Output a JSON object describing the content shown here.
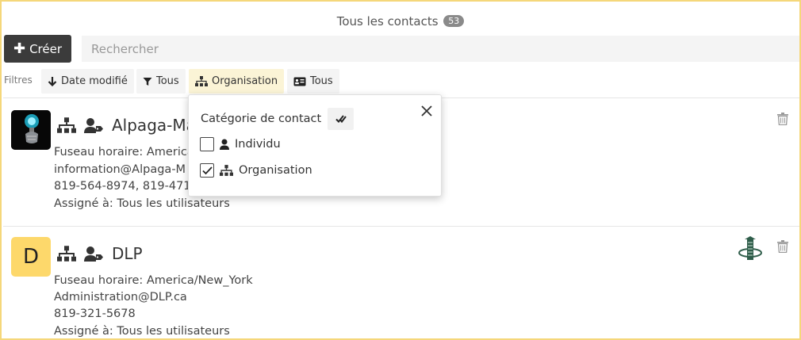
{
  "header": {
    "title": "Tous les contacts",
    "count": "53"
  },
  "toolbar": {
    "create_label": "Créer",
    "search_placeholder": "Rechercher"
  },
  "filters": {
    "label": "Filtres",
    "chips": [
      {
        "label": "Date modifié",
        "icon": "arrow-down-icon"
      },
      {
        "label": "Tous",
        "icon": "filter-icon"
      },
      {
        "label": "Organisation",
        "icon": "org-chart-icon",
        "active": true
      },
      {
        "label": "Tous",
        "icon": "id-card-icon"
      }
    ]
  },
  "popover": {
    "title": "Catégorie de contact",
    "options": [
      {
        "label": "Individu",
        "checked": false,
        "icon": "person-icon"
      },
      {
        "label": "Organisation",
        "checked": true,
        "icon": "org-chart-icon"
      }
    ]
  },
  "contacts": [
    {
      "name": "Alpaga-Ma",
      "avatar": "image",
      "timezone": "Fuseau horaire: America",
      "email": "information@Alpaga-M",
      "phone": "819-564-8974, 819-471-8",
      "assigned": "Assigné à: Tous les utilisateurs"
    },
    {
      "name": "DLP",
      "avatar_letter": "D",
      "timezone": "Fuseau horaire: America/New_York",
      "email": "Administration@DLP.ca",
      "phone": "819-321-5678",
      "assigned": "Assigné à: Tous les utilisateurs"
    }
  ],
  "colors": {
    "accent_border": "#f5d77a",
    "active_chip": "#fbf4d6",
    "avatar_letter_bg": "#fdd86b",
    "create_button": "#3b3b3b"
  }
}
